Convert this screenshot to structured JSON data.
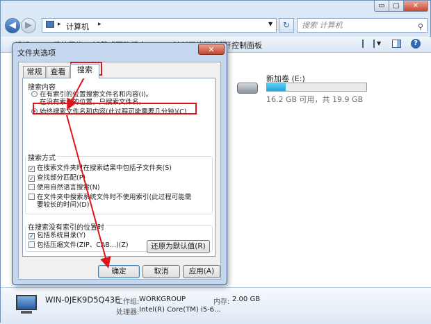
{
  "window": {
    "controls": {
      "minimize": "▭",
      "maximize": "▢",
      "close": "✕"
    }
  },
  "address_bar": {
    "path": "计算机",
    "path_sep": "▸",
    "refresh": "↻",
    "search_placeholder": "搜索 计算机"
  },
  "toolbar": {
    "items": [
      "组织 ▾",
      "系统属性",
      "卸载或更改程序",
      "映射网络驱动器",
      "打开控制面板"
    ]
  },
  "drive": {
    "name": "新加卷 (E:)",
    "info": "16.2 GB 可用，共 19.9 GB",
    "used_fraction": 0.19
  },
  "details": {
    "computer_name": "WIN-0JEK9D5Q43E",
    "workgroup_label": "工作组:",
    "workgroup": "WORKGROUP",
    "memory_label": "内存:",
    "memory": "2.00 GB",
    "cpu_label": "处理器:",
    "cpu": "Intel(R) Core(TM) i5-6..."
  },
  "dialog": {
    "title": "文件夹选项",
    "close": "✕",
    "tabs": [
      "常规",
      "查看",
      "搜索"
    ],
    "active_tab": "搜索",
    "search_content": {
      "title": "搜索内容",
      "option1_line1": "在有索引的位置搜索文件名和内容(I)。",
      "option1_line2": "在没有索引的位置，只搜索文件名。",
      "option2": "始终搜索文件名和内容(此过程可能需要几分钟)(C)"
    },
    "search_method": {
      "title": "搜索方式",
      "items": [
        {
          "label": "在搜索文件夹时在搜索结果中包括子文件夹(S)",
          "checked": true
        },
        {
          "label": "查找部分匹配(P)",
          "checked": true
        },
        {
          "label": "使用自然语言搜索(N)",
          "checked": false
        },
        {
          "label": "在文件夹中搜索系统文件时不使用索引(此过程可能需",
          "label2": "要较长的时间)(D)",
          "checked": false
        }
      ]
    },
    "no_index": {
      "title": "在搜索没有索引的位置时",
      "items": [
        {
          "label": "包括系统目录(Y)",
          "checked": true
        },
        {
          "label": "包括压缩文件(ZIP、CAB...)(Z)",
          "checked": false
        }
      ]
    },
    "restore_defaults": "还原为默认值(R)",
    "ok": "确定",
    "cancel": "取消",
    "apply": "应用(A)"
  },
  "annotations": {
    "color": "#e0141b"
  }
}
